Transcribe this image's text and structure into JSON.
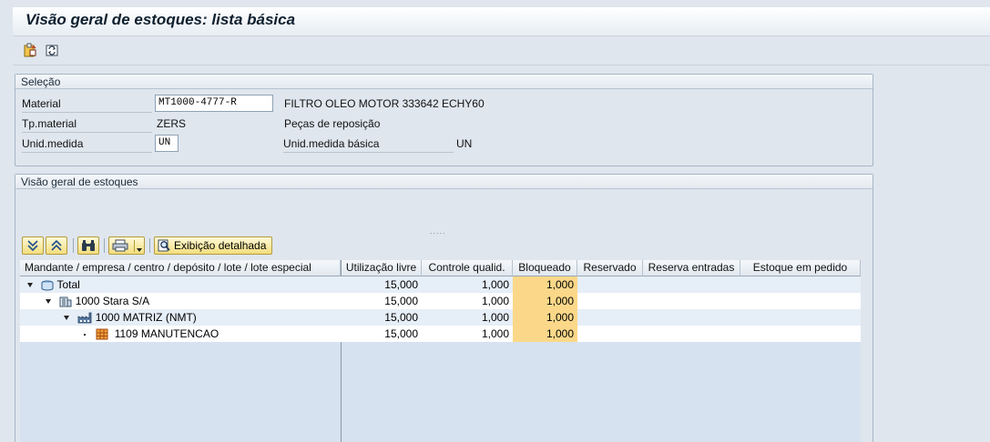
{
  "window": {
    "title": "Visão geral de estoques: lista básica"
  },
  "toolbar": {
    "buttons": [
      "clipboard-icon",
      "refresh-icon"
    ]
  },
  "selection": {
    "title": "Seleção",
    "material_label": "Material",
    "material_value": "MT1000-4777-R",
    "material_desc": "FILTRO OLEO MOTOR 333642 ECHY60",
    "type_label": "Tp.material",
    "type_value": "ZERS",
    "type_desc": "Peças de reposição",
    "unit_label": "Unid.medida",
    "unit_value": "UN",
    "base_unit_label": "Unid.medida básica",
    "base_unit_value": "UN"
  },
  "overview": {
    "title": "Visão geral de estoques",
    "splitter": ".....",
    "detail_button": "Exibição detalhada"
  },
  "table": {
    "headers": [
      "Mandante / empresa / centro / depósito / lote / lote especial",
      "Utilização livre",
      "Controle qualid.",
      "Bloqueado",
      "Reservado",
      "Reserva entradas",
      "Estoque em pedido"
    ],
    "rows": [
      {
        "label": "Total",
        "livre": "15,000",
        "qualid": "1,000",
        "bloqueado": "1,000",
        "reservado": "",
        "reserva_entradas": "",
        "em_pedido": ""
      },
      {
        "label": "1000 Stara S/A",
        "livre": "15,000",
        "qualid": "1,000",
        "bloqueado": "1,000",
        "reservado": "",
        "reserva_entradas": "",
        "em_pedido": ""
      },
      {
        "label": "1000 MATRIZ (NMT)",
        "livre": "15,000",
        "qualid": "1,000",
        "bloqueado": "1,000",
        "reservado": "",
        "reserva_entradas": "",
        "em_pedido": ""
      },
      {
        "label": "1109 MANUTENCAO",
        "livre": "15,000",
        "qualid": "1,000",
        "bloqueado": "1,000",
        "reservado": "",
        "reserva_entradas": "",
        "em_pedido": ""
      }
    ]
  },
  "colors": {
    "blocked_highlight": "#fbd889",
    "row_alt": "#ffffff",
    "row_base": "#e6eef7"
  }
}
